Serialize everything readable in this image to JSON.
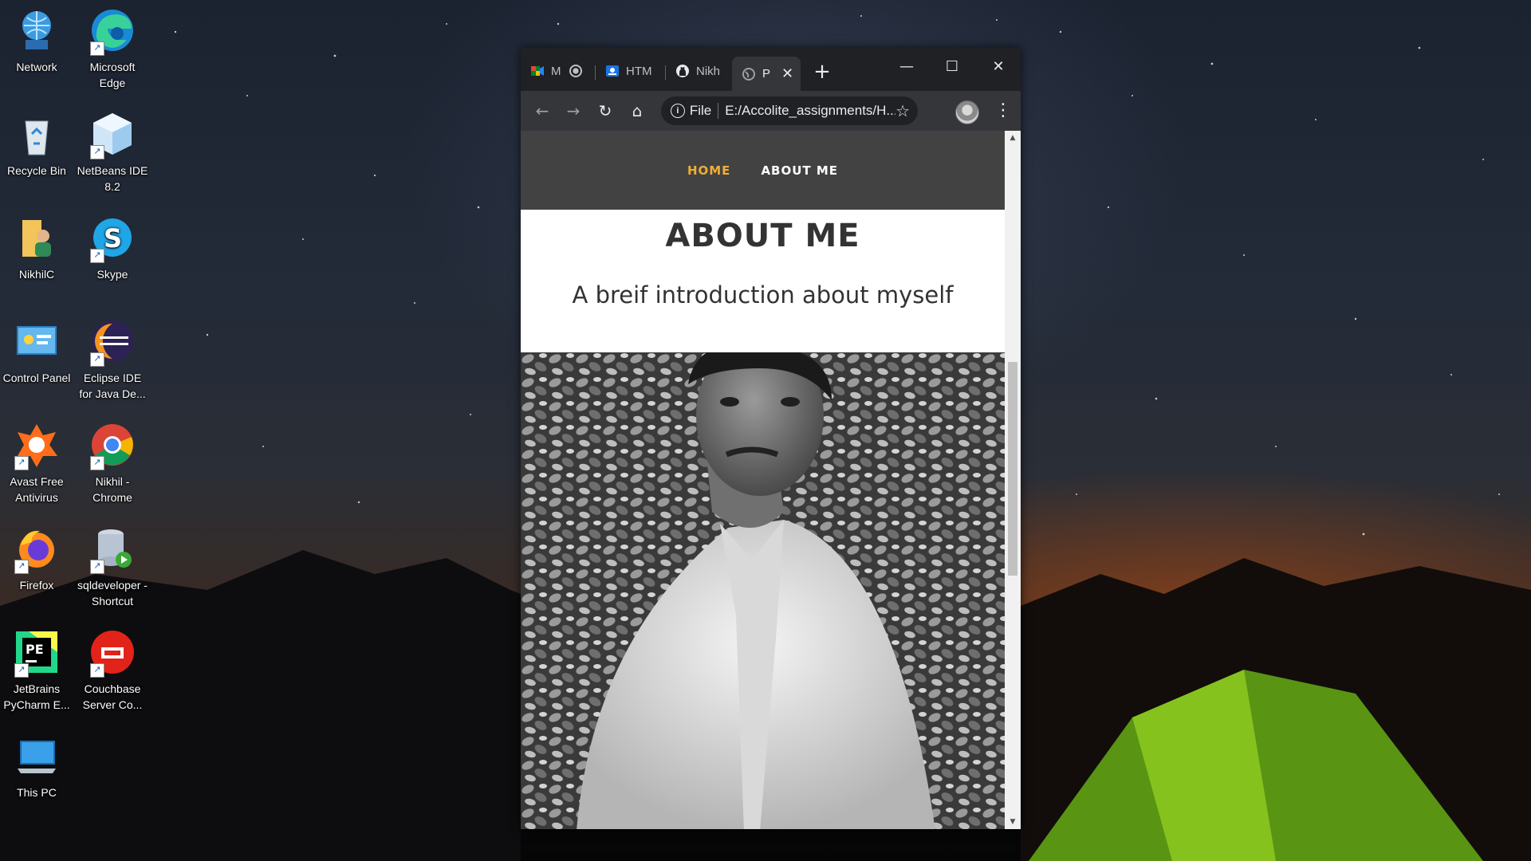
{
  "desktop": {
    "icons": [
      {
        "label": "Network",
        "icon": "network-icon"
      },
      {
        "label": "Microsoft Edge",
        "icon": "edge-icon"
      },
      {
        "label": "Recycle Bin",
        "icon": "recycle-bin-icon"
      },
      {
        "label": "NetBeans IDE 8.2",
        "icon": "netbeans-icon"
      },
      {
        "label": "NikhilC",
        "icon": "user-folder-icon"
      },
      {
        "label": "Skype",
        "icon": "skype-icon"
      },
      {
        "label": "Control Panel",
        "icon": "control-panel-icon"
      },
      {
        "label": "Eclipse IDE for Java De...",
        "icon": "eclipse-icon"
      },
      {
        "label": "Avast Free Antivirus",
        "icon": "avast-icon"
      },
      {
        "label": "Nikhil - Chrome",
        "icon": "chrome-icon"
      },
      {
        "label": "Firefox",
        "icon": "firefox-icon"
      },
      {
        "label": "sqldeveloper - Shortcut",
        "icon": "sqldeveloper-icon"
      },
      {
        "label": "JetBrains PyCharm E...",
        "icon": "pycharm-icon"
      },
      {
        "label": "Couchbase Server Co...",
        "icon": "couchbase-icon"
      },
      {
        "label": "This PC",
        "icon": "this-pc-icon"
      }
    ]
  },
  "browser": {
    "tabs": [
      {
        "label": "M",
        "icon": "meet-icon"
      },
      {
        "label": "HTM",
        "icon": "classroom-icon"
      },
      {
        "label": "Nikh",
        "icon": "github-icon"
      },
      {
        "label": "P",
        "icon": "globe-icon",
        "active": true
      }
    ],
    "new_tab": "+",
    "address": {
      "chip": "File",
      "url": "E:/Accolite_assignments/H..."
    }
  },
  "page": {
    "nav": {
      "home": "HOME",
      "about": "ABOUT ME",
      "active": "HOME"
    },
    "title": "ABOUT ME",
    "subtitle": "A breif introduction about myself",
    "photo": "profile-photo-black-and-white"
  },
  "colors": {
    "nav_bg": "#424242",
    "nav_active": "#f0ad36",
    "chrome_dark": "#202124",
    "chrome_toolbar": "#35363a"
  }
}
